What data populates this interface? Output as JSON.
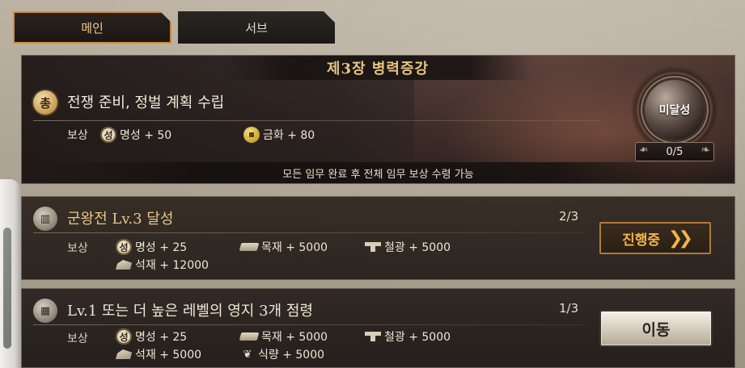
{
  "tabs": [
    {
      "label": "메인"
    },
    {
      "label": "서브"
    }
  ],
  "chapter": {
    "title": "제3장 병력증강",
    "quest_icon_label": "총",
    "quest": "전쟁 준비, 정벌 계획 수립",
    "reward_label": "보상",
    "rewards": [
      {
        "icon": "fame-icon",
        "icon_label": "성",
        "text": "명성 + 50"
      },
      {
        "icon": "gold-coin-icon",
        "text": "금화 + 80"
      }
    ],
    "footer": "모든 임무 완료 후 전체 임무 보상 수령 가능",
    "status": "미달성",
    "progress": "0/5"
  },
  "quests": [
    {
      "icon": "castle-icon",
      "title": "군왕전 Lv.3 달성",
      "count": "2/3",
      "reward_label": "보상",
      "rewards": [
        {
          "icon": "fame-icon",
          "icon_label": "성",
          "text": "명성 + 25"
        },
        {
          "icon": "wood-icon",
          "text": "목재 + 5000"
        },
        {
          "icon": "iron-ore-icon",
          "text": "철광 + 5000"
        },
        {
          "icon": "stone-icon",
          "text": "석재 + 12000"
        }
      ],
      "button": "진행중"
    },
    {
      "icon": "territory-icon",
      "title": "Lv.1 또는 더 높은 레벨의 영지 3개 점령",
      "count": "1/3",
      "reward_label": "보상",
      "rewards": [
        {
          "icon": "fame-icon",
          "icon_label": "성",
          "text": "명성 + 25"
        },
        {
          "icon": "wood-icon",
          "text": "목재 + 5000"
        },
        {
          "icon": "iron-ore-icon",
          "text": "철광 + 5000"
        },
        {
          "icon": "stone-icon",
          "text": "석재 + 5000"
        },
        {
          "icon": "food-icon",
          "text": "식량 + 5000"
        }
      ],
      "button": "이동"
    }
  ],
  "colors": {
    "accent_gold": "#e6c483",
    "progress_orange": "#f2b34c",
    "tab_active_border": "#d48d3c"
  }
}
